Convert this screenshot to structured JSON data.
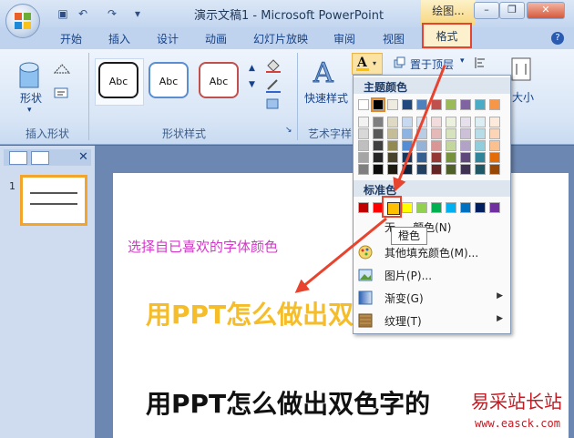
{
  "window": {
    "title": "演示文稿1 - Microsoft PowerPoint",
    "context_tab": "绘图..."
  },
  "tabs": [
    "开始",
    "插入",
    "设计",
    "动画",
    "幻灯片放映",
    "审阅",
    "视图"
  ],
  "active_tab": "格式",
  "ribbon": {
    "insert_shapes": {
      "shapes_label": "形状",
      "group_label": "插入形状"
    },
    "shape_styles": {
      "styles": [
        "Abc",
        "Abc",
        "Abc"
      ],
      "group_label": "形状样式"
    },
    "wordart": {
      "quick_styles_label": "快速样式",
      "group_label": "艺术字样"
    },
    "arrange": {
      "bring_front_label": "置于顶层"
    },
    "size": {
      "label": "大小"
    }
  },
  "color_menu": {
    "theme_header": "主题颜色",
    "standard_header": "标准色",
    "theme_top_row": [
      "#ffffff",
      "#000000",
      "#eeece1",
      "#1f497d",
      "#4f81bd",
      "#c0504d",
      "#9bbb59",
      "#8064a2",
      "#4bacc6",
      "#f79646"
    ],
    "theme_shades": [
      [
        "#f2f2f2",
        "#7f7f7f",
        "#ddd9c3",
        "#c6d9f0",
        "#dbe5f1",
        "#f2dcdb",
        "#ebf1dd",
        "#e5e0ec",
        "#dbeef3",
        "#fdeada"
      ],
      [
        "#d8d8d8",
        "#595959",
        "#c4bd97",
        "#8db3e2",
        "#b8cce4",
        "#e5b9b7",
        "#d7e3bc",
        "#ccc1d9",
        "#b7dde8",
        "#fbd5b5"
      ],
      [
        "#bfbfbf",
        "#3f3f3f",
        "#938953",
        "#548dd4",
        "#95b3d7",
        "#d99694",
        "#c3d69b",
        "#b2a2c7",
        "#92cddc",
        "#fac08f"
      ],
      [
        "#a5a5a5",
        "#262626",
        "#494429",
        "#17365d",
        "#366092",
        "#953734",
        "#76923c",
        "#5f497a",
        "#31859b",
        "#e36c09"
      ],
      [
        "#7f7f7f",
        "#0c0c0c",
        "#1d1b10",
        "#0f243e",
        "#244061",
        "#632423",
        "#4f6128",
        "#3f3151",
        "#205867",
        "#974806"
      ]
    ],
    "standard_colors": [
      "#c00000",
      "#ff0000",
      "#ffc000",
      "#ffff00",
      "#92d050",
      "#00b050",
      "#00b0f0",
      "#0070c0",
      "#002060",
      "#7030a0"
    ],
    "no_fill": {
      "label": "无",
      "suffix": "颜色(N)"
    },
    "more_colors": "其他填充颜色(M)...",
    "picture": "图片(P)...",
    "gradient": "渐变(G)",
    "texture": "纹理(T)",
    "tooltip": "橙色"
  },
  "slide_pane": {
    "slide_number": "1"
  },
  "slide": {
    "hint": "选择自已喜欢的字体颜色",
    "line1": "用PPT怎么做出双色字的效果",
    "line2": "用PPT怎么做出双色字的"
  },
  "watermark": {
    "top": "易采站长站",
    "bottom": "www.easck.com"
  },
  "colors": {
    "accent_red": "#e8432f",
    "selected_color": "#ffc000",
    "slide_text_gold": "#f6bd2a",
    "hint_pink": "#d437c9"
  }
}
